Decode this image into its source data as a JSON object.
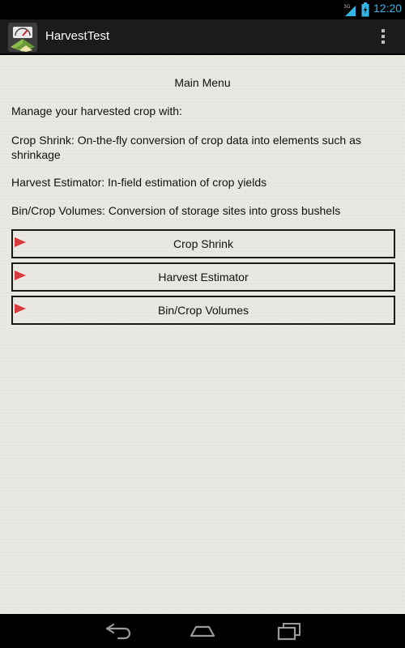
{
  "status_bar": {
    "network": "3G",
    "time": "12:20"
  },
  "action_bar": {
    "title": "HarvestTest",
    "icons": {
      "app": "app-icon",
      "overflow": "overflow-menu-icon"
    }
  },
  "main": {
    "title": "Main Menu",
    "intro": "Manage your harvested crop with:",
    "descriptions": [
      "Crop Shrink: On-the-fly conversion of crop data into elements such as shrinkage",
      "Harvest Estimator: In-field estimation of crop yields",
      "Bin/Crop Volumes: Conversion of storage sites into gross bushels"
    ],
    "buttons": [
      {
        "label": "Crop Shrink",
        "icon": "red-arrow-icon"
      },
      {
        "label": "Harvest Estimator",
        "icon": "red-arrow-icon"
      },
      {
        "label": "Bin/Crop Volumes",
        "icon": "red-arrow-icon"
      }
    ]
  },
  "nav_bar": {
    "icons": [
      "back-icon",
      "home-icon",
      "recents-icon"
    ]
  },
  "colors": {
    "accent": "#33b5e5",
    "arrow": "#d63a3a",
    "background": "#e9e7e2"
  }
}
